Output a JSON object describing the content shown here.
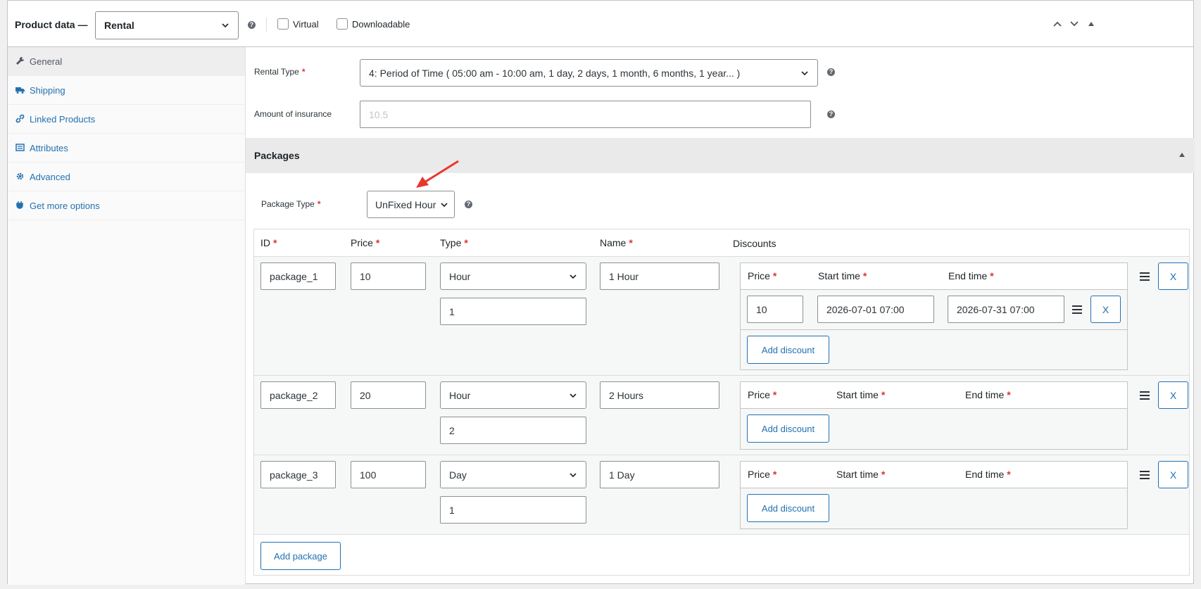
{
  "header": {
    "title": "Product data —",
    "product_type": "Rental",
    "virtual_label": "Virtual",
    "downloadable_label": "Downloadable"
  },
  "sidebar": {
    "items": [
      {
        "label": "General",
        "icon": "wrench-icon"
      },
      {
        "label": "Shipping",
        "icon": "truck-icon"
      },
      {
        "label": "Linked Products",
        "icon": "link-icon"
      },
      {
        "label": "Attributes",
        "icon": "list-icon"
      },
      {
        "label": "Advanced",
        "icon": "gear-icon"
      },
      {
        "label": "Get more options",
        "icon": "plugin-icon"
      }
    ]
  },
  "rental_type": {
    "label": "Rental Type",
    "value": "4: Period of Time ( 05:00 am - 10:00 am, 1 day, 2 days, 1 month, 6 months, 1 year... )"
  },
  "insurance": {
    "label": "Amount of insurance",
    "placeholder": "10.5"
  },
  "packages": {
    "title": "Packages",
    "type_label": "Package Type",
    "type_value": "UnFixed Hour",
    "columns": {
      "id": "ID",
      "price": "Price",
      "type": "Type",
      "name": "Name",
      "discounts": "Discounts"
    },
    "discount_columns": {
      "price": "Price",
      "start": "Start time",
      "end": "End time"
    },
    "rows": [
      {
        "id": "package_1",
        "price": "10",
        "type": "Hour",
        "qty": "1",
        "name": "1 Hour",
        "discounts": [
          {
            "price": "10",
            "start": "2026-07-01 07:00",
            "end": "2026-07-31 07:00"
          }
        ]
      },
      {
        "id": "package_2",
        "price": "20",
        "type": "Hour",
        "qty": "2",
        "name": "2 Hours",
        "discounts": []
      },
      {
        "id": "package_3",
        "price": "100",
        "type": "Day",
        "qty": "1",
        "name": "1 Day",
        "discounts": []
      }
    ],
    "add_discount_label": "Add discount",
    "remove_label": "X",
    "add_package_label": "Add package"
  },
  "colors": {
    "accent": "#2271b1",
    "required": "#d63638",
    "arrow": "#e8382c"
  }
}
